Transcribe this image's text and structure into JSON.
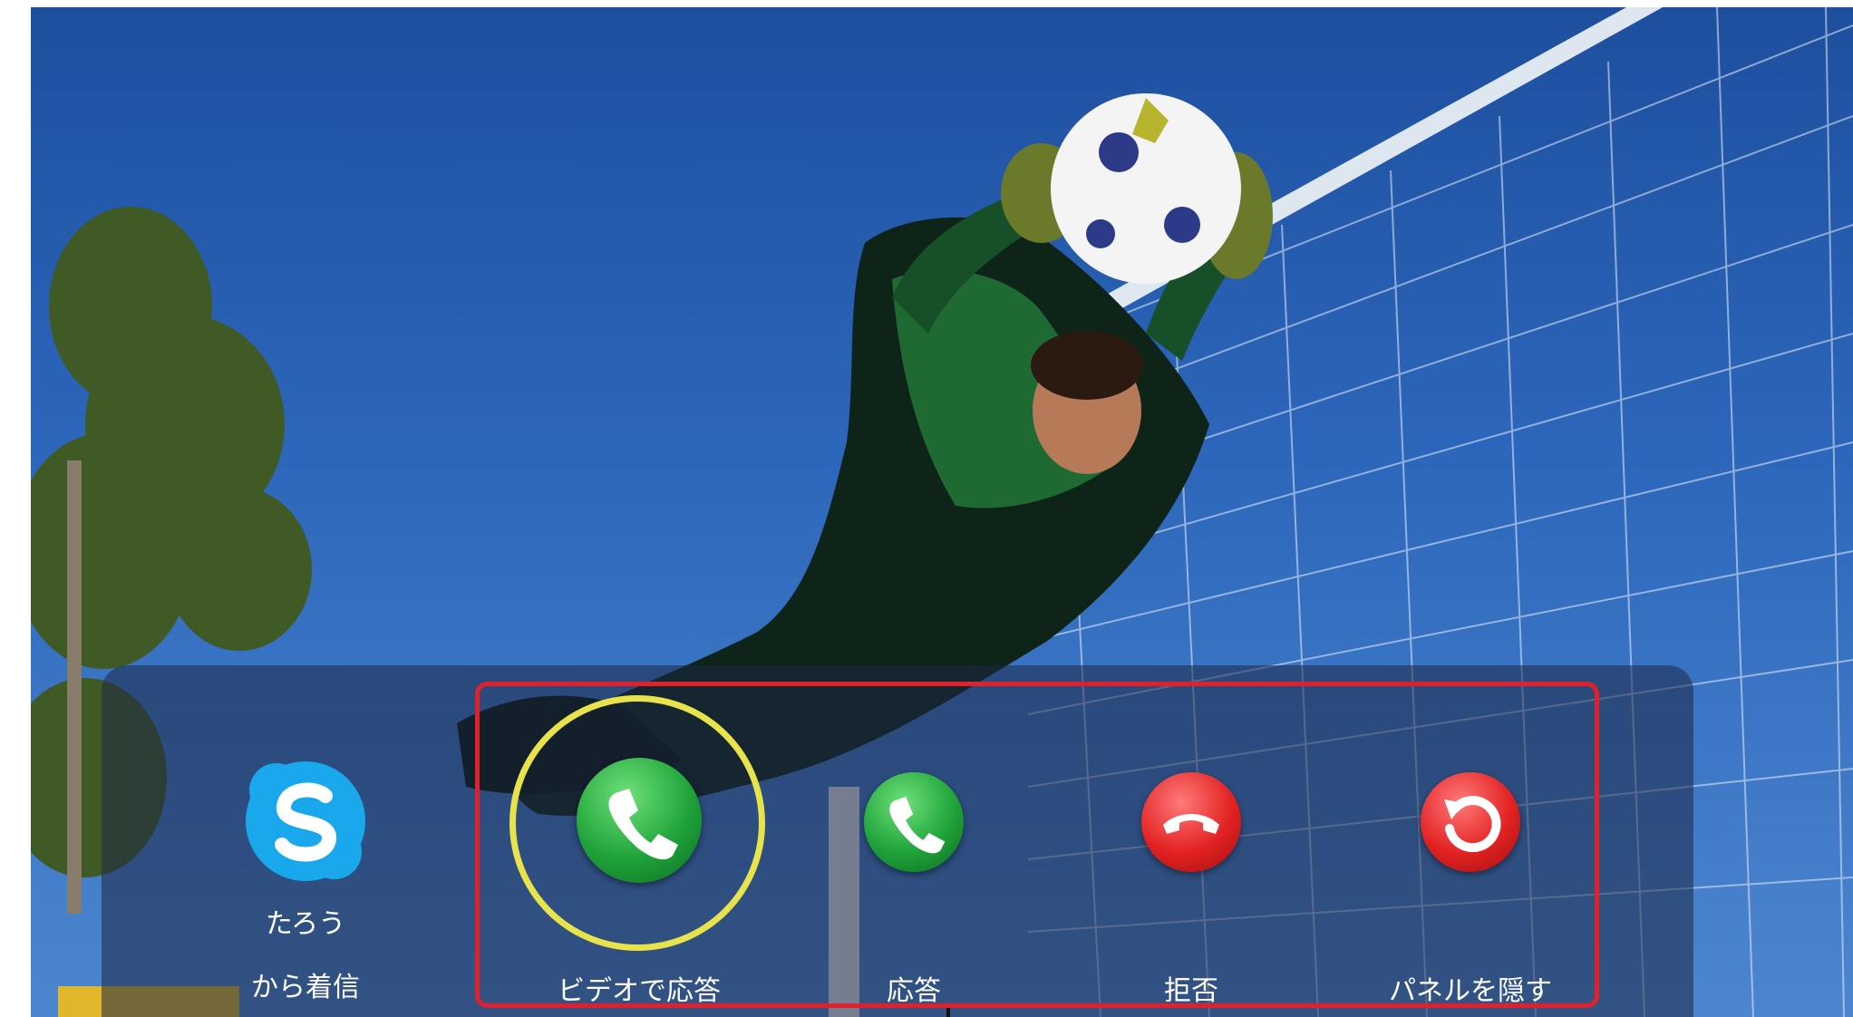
{
  "caller": {
    "app_icon": "skype-icon",
    "name": "たろう",
    "status": "から着信"
  },
  "actions": [
    {
      "id": "video-answer",
      "label": "ビデオで応答",
      "icon": "phone-icon",
      "color": "#1fa33a",
      "highlighted": true
    },
    {
      "id": "answer",
      "label": "応答",
      "icon": "phone-icon",
      "color": "#1fa33a",
      "highlighted": false
    },
    {
      "id": "reject",
      "label": "拒否",
      "icon": "hang-up-icon",
      "color": "#e32222",
      "highlighted": false
    },
    {
      "id": "hide-panel",
      "label": "パネルを隠す",
      "icon": "undo-icon",
      "color": "#e32222",
      "highlighted": false
    }
  ],
  "colors": {
    "highlight_frame": "#e0202a",
    "highlight_ring": "#e8e34a"
  }
}
